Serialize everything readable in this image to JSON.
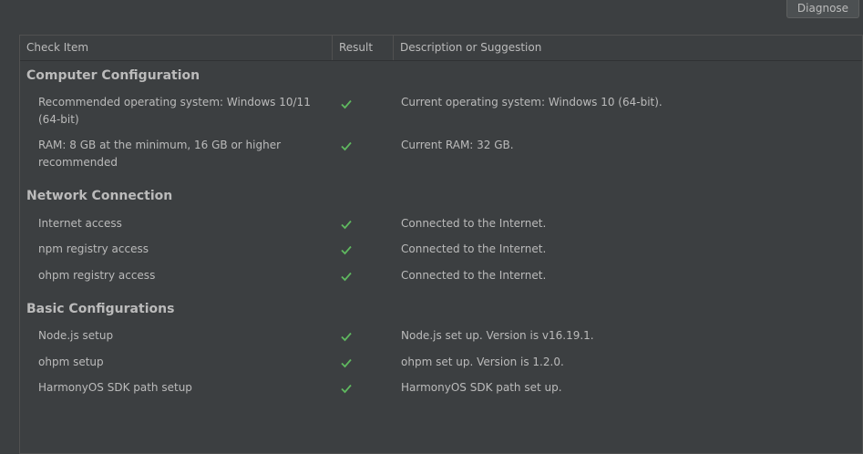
{
  "toolbar": {
    "diagnose_label": "Diagnose"
  },
  "table": {
    "headers": {
      "check_item": "Check Item",
      "result": "Result",
      "description": "Description or Suggestion"
    },
    "colors": {
      "check": "#5fb85f"
    },
    "sections": [
      {
        "title": "Computer Configuration",
        "rows": [
          {
            "item": "Recommended operating system: Windows 10/11 (64-bit)",
            "result": "check-icon",
            "description": "Current operating system: Windows 10 (64-bit)."
          },
          {
            "item": "RAM: 8 GB at the minimum, 16 GB or higher recommended",
            "result": "check-icon",
            "description": "Current RAM: 32 GB."
          }
        ]
      },
      {
        "title": "Network Connection",
        "rows": [
          {
            "item": "Internet access",
            "result": "check-icon",
            "description": "Connected to the Internet."
          },
          {
            "item": "npm registry access",
            "result": "check-icon",
            "description": "Connected to the Internet."
          },
          {
            "item": "ohpm registry access",
            "result": "check-icon",
            "description": "Connected to the Internet."
          }
        ]
      },
      {
        "title": "Basic Configurations",
        "rows": [
          {
            "item": "Node.js setup",
            "result": "check-icon",
            "description": "Node.js set up. Version is v16.19.1."
          },
          {
            "item": "ohpm setup",
            "result": "check-icon",
            "description": "ohpm set up. Version is 1.2.0."
          },
          {
            "item": "HarmonyOS SDK path setup",
            "result": "check-icon",
            "description": "HarmonyOS SDK path set up."
          }
        ]
      }
    ]
  }
}
